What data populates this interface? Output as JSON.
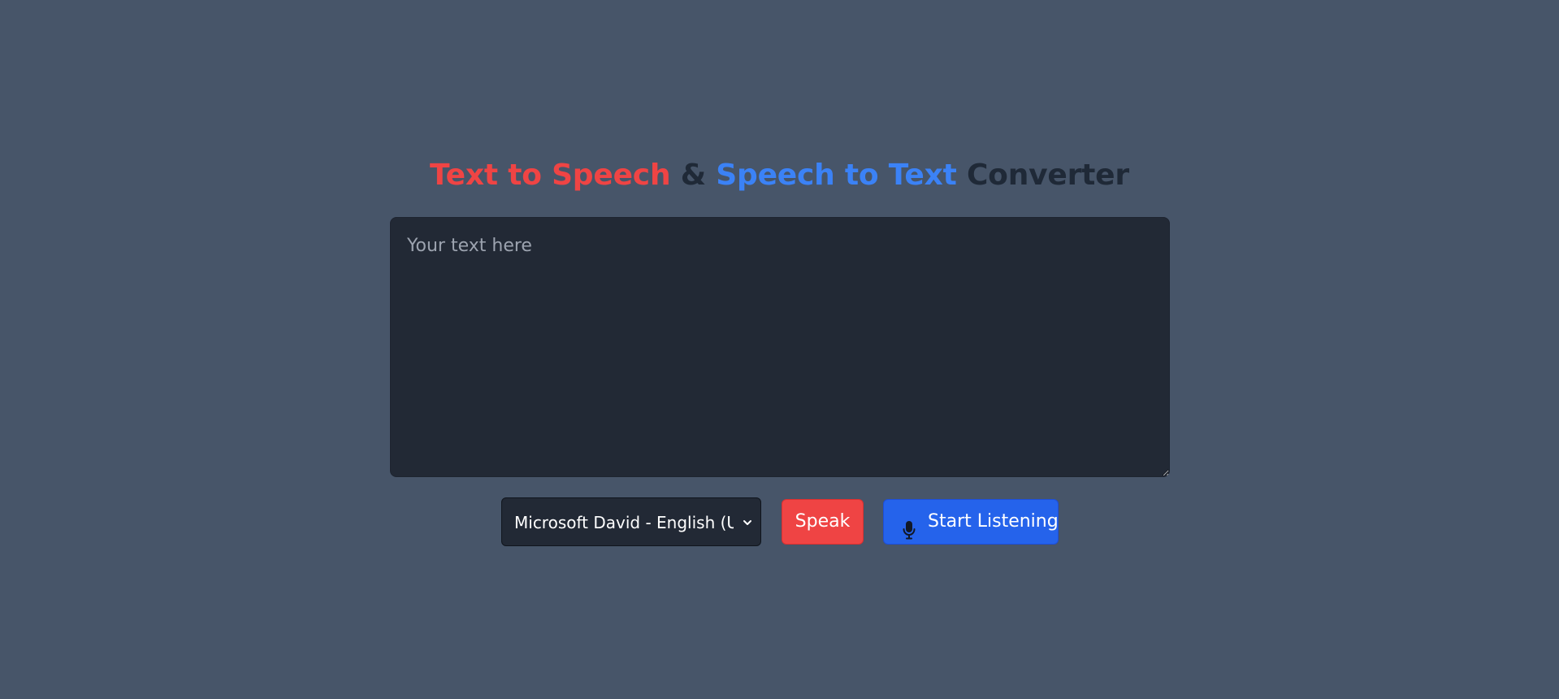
{
  "header": {
    "title_part1": "Text to Speech",
    "title_amp": "&",
    "title_part2": "Speech to Text",
    "title_part3": "Converter"
  },
  "editor": {
    "placeholder": "Your text here",
    "value": ""
  },
  "controls": {
    "voice_select": {
      "selected": "Microsoft David - English (United States)",
      "icon": "chevron-down-icon"
    },
    "speak_label": "Speak",
    "listen_label": "Start Listening",
    "listen_icon": "microphone-icon"
  },
  "colors": {
    "background": "#475569",
    "accent_red": "#ef4444",
    "accent_blue": "#3b82f6",
    "button_blue": "#2563eb",
    "dark_text": "#1f2937",
    "panel": "#222935"
  }
}
